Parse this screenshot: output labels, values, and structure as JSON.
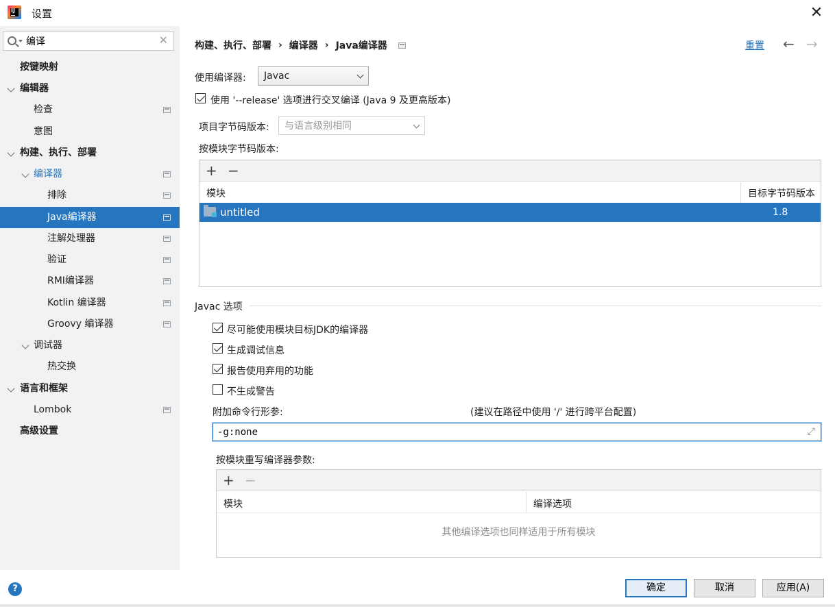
{
  "window": {
    "title": "设置",
    "close_glyph": "✕"
  },
  "sidebar": {
    "search": {
      "value": "编译",
      "clear_glyph": "✕"
    },
    "items": [
      {
        "label": "按键映射"
      },
      {
        "label": "编辑器"
      },
      {
        "label": "检查"
      },
      {
        "label": "意图"
      },
      {
        "label": "构建、执行、部署"
      },
      {
        "label": "编译器"
      },
      {
        "label": "排除"
      },
      {
        "label": "Java编译器"
      },
      {
        "label": "注解处理器"
      },
      {
        "label": "验证"
      },
      {
        "label": "RMI编译器"
      },
      {
        "label": "Kotlin 编译器"
      },
      {
        "label": "Groovy 编译器"
      },
      {
        "label": "调试器"
      },
      {
        "label": "热交换"
      },
      {
        "label": "语言和框架"
      },
      {
        "label": "Lombok"
      },
      {
        "label": "高级设置"
      }
    ],
    "help_glyph": "?"
  },
  "breadcrumb": {
    "parts": [
      "构建、执行、部署",
      "编译器",
      "Java编译器"
    ],
    "separator": "›"
  },
  "header": {
    "reset_label": "重置",
    "back_glyph": "←",
    "forward_glyph": "→"
  },
  "compiler": {
    "label": "使用编译器:",
    "value": "Javac",
    "release_option": {
      "label": "使用 '--release' 选项进行交叉编译 (Java 9 及更高版本)",
      "checked": true
    }
  },
  "bytecode": {
    "project_label": "项目字节码版本:",
    "project_value": "与语言级别相同",
    "per_module_label": "按模块字节码版本:",
    "add_glyph": "+",
    "remove_glyph": "−",
    "columns": [
      "模块",
      "目标字节码版本"
    ],
    "rows": [
      {
        "module": "untitled",
        "version": "1.8"
      }
    ]
  },
  "javac": {
    "section_title": "Javac 选项",
    "options": [
      {
        "label": "尽可能使用模块目标JDK的编译器",
        "checked": true
      },
      {
        "label": "生成调试信息",
        "checked": true
      },
      {
        "label": "报告使用弃用的功能",
        "checked": true
      },
      {
        "label": "不生成警告",
        "checked": false
      }
    ],
    "params_label": "附加命令行形参:",
    "params_hint": "(建议在路径中使用 '/' 进行跨平台配置)",
    "params_value": "-g:none",
    "expand_glyph": "⤢",
    "override_label": "按模块重写编译器参数:",
    "override_add_glyph": "+",
    "override_remove_glyph": "−",
    "override_columns": [
      "模块",
      "编译选项"
    ],
    "override_empty": "其他编译选项也同样适用于所有模块"
  },
  "footer": {
    "ok_label": "确定",
    "cancel_label": "取消",
    "apply_label": "应用(A)"
  },
  "colors": {
    "accent": "#2675bf",
    "sidebar_bg": "#f2f2f2"
  },
  "icons": [
    "app-logo-icon",
    "search-icon",
    "clear-icon",
    "settings-page-icon",
    "folder-module-icon",
    "expand-icon",
    "help-icon"
  ]
}
